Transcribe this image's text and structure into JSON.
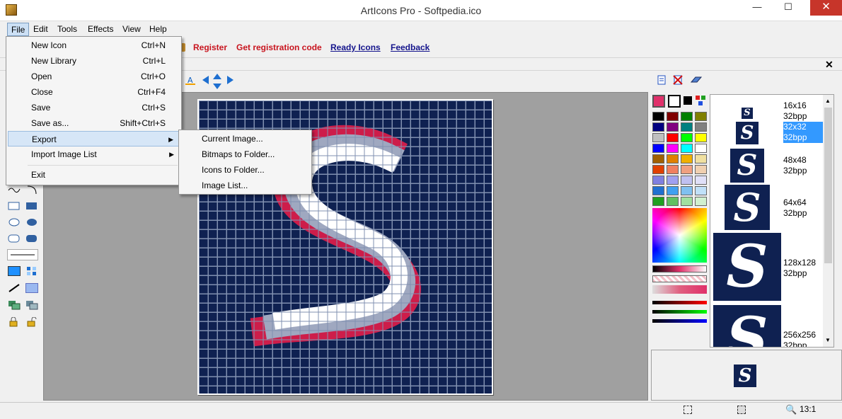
{
  "window": {
    "title": "ArtIcons Pro - Softpedia.ico",
    "minimize": "—",
    "maximize": "☐",
    "close": "✕"
  },
  "menubar": [
    "File",
    "Edit",
    "Tools",
    "Effects",
    "View",
    "Help"
  ],
  "links": {
    "register": "Register",
    "get_code": "Get registration code",
    "ready_icons": "Ready Icons",
    "feedback": "Feedback"
  },
  "panel_close": "✕",
  "file_menu": {
    "items": [
      {
        "label": "New Icon",
        "shortcut": "Ctrl+N"
      },
      {
        "label": "New Library",
        "shortcut": "Ctrl+L"
      },
      {
        "label": "Open",
        "shortcut": "Ctrl+O"
      },
      {
        "label": "Close",
        "shortcut": "Ctrl+F4"
      },
      {
        "label": "Save",
        "shortcut": "Ctrl+S"
      },
      {
        "label": "Save as...",
        "shortcut": "Shift+Ctrl+S"
      },
      {
        "label": "Export",
        "shortcut": ""
      },
      {
        "label": "Import Image List",
        "shortcut": ""
      },
      {
        "label": "Exit",
        "shortcut": ""
      }
    ]
  },
  "export_submenu": [
    "Current Image...",
    "Bitmaps to Folder...",
    "Icons to Folder...",
    "Image List..."
  ],
  "sizes": [
    {
      "dim": "16x16",
      "bpp": "32bpp"
    },
    {
      "dim": "32x32",
      "bpp": "32bpp"
    },
    {
      "dim": "48x48",
      "bpp": "32bpp"
    },
    {
      "dim": "64x64",
      "bpp": "32bpp"
    },
    {
      "dim": "128x128",
      "bpp": "32bpp"
    },
    {
      "dim": "256x256",
      "bpp": "32bpp"
    }
  ],
  "thumb_glyph": "S",
  "status": {
    "zoom": "13:1"
  },
  "colors": {
    "canvas_bg": "#0f2151",
    "accent_red": "#c8141e",
    "link_blue": "#14148c",
    "selection": "#3399ff"
  }
}
